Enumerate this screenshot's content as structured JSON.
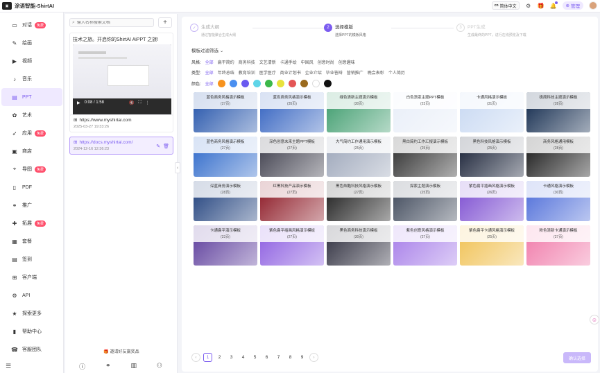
{
  "app": {
    "title": "涂语智能-ShirtAI"
  },
  "topbar": {
    "lang_code": "cn",
    "lang_label": "简体中文",
    "manage_label": "管理"
  },
  "sidebar": {
    "items": [
      {
        "label": "对话",
        "icon": "chat-icon",
        "badge": "免费"
      },
      {
        "label": "绘画",
        "icon": "paint-icon",
        "badge": ""
      },
      {
        "label": "视频",
        "icon": "video-icon",
        "badge": ""
      },
      {
        "label": "音乐",
        "icon": "music-icon",
        "badge": ""
      },
      {
        "label": "PPT",
        "icon": "ppt-icon",
        "badge": "",
        "active": true
      },
      {
        "label": "艺术",
        "icon": "art-icon",
        "badge": ""
      },
      {
        "label": "应用",
        "icon": "rocket-icon",
        "badge": "免费"
      },
      {
        "label": "商店",
        "icon": "store-icon",
        "badge": ""
      },
      {
        "label": "导图",
        "icon": "mindmap-icon",
        "badge": "免费"
      },
      {
        "label": "PDF",
        "icon": "pdf-icon",
        "badge": ""
      },
      {
        "label": "推广",
        "icon": "promote-icon",
        "badge": ""
      },
      {
        "label": "拓展",
        "icon": "puzzle-icon",
        "badge": "免费"
      },
      {
        "label": "套餐",
        "icon": "package-icon",
        "badge": ""
      },
      {
        "label": "签到",
        "icon": "calendar-icon",
        "badge": ""
      },
      {
        "label": "客户端",
        "icon": "windows-icon",
        "badge": ""
      },
      {
        "label": "API",
        "icon": "api-icon",
        "badge": ""
      },
      {
        "label": "探索更多",
        "icon": "star-icon",
        "badge": ""
      },
      {
        "label": "帮助中心",
        "icon": "doc-icon",
        "badge": ""
      },
      {
        "label": "客服团队",
        "icon": "support-icon",
        "badge": ""
      }
    ]
  },
  "history": {
    "search_placeholder": "输入名称搜索文档",
    "video_title": "技术之旅。开启你的ShirtAI AiPPT 之旅!",
    "video_time": "0:08 / 1:58",
    "items": [
      {
        "url": "https://www.myshirtai.com",
        "date": "2025-03-27 19:33:26"
      },
      {
        "url": "https://docs.myshirtai.com/",
        "date": "2024-12-16 12:36:23"
      }
    ],
    "invite_label": "邀请好友赢奖品"
  },
  "steps": [
    {
      "num": "✓",
      "title": "生成大纲",
      "sub": "通过智能聚合生成大纲"
    },
    {
      "num": "2",
      "title": "选择模版",
      "sub": "选择PPT的模板风格"
    },
    {
      "num": "3",
      "title": "PPT生成",
      "sub": "生成最终的PPT，进行在线预览及下载"
    }
  ],
  "filters": {
    "toggle_label": "模板过滤筛选",
    "style_label": "风格:",
    "styles": [
      "全部",
      "扁平简约",
      "商务科技",
      "文艺清新",
      "卡通手绘",
      "中国风",
      "创意时尚",
      "创意趣味"
    ],
    "type_label": "类型:",
    "types": [
      "全部",
      "年终总结",
      "教育培训",
      "医学医疗",
      "商业计划书",
      "企业介绍",
      "毕业答辩",
      "营销推广",
      "晚会表彰",
      "个人简历"
    ],
    "color_label": "颜色:",
    "color_all": "全部",
    "colors": [
      "#f7931e",
      "#4a8ff0",
      "#6a5af0",
      "#5fd5e8",
      "#3cb84a",
      "#e8e23c",
      "#e45656",
      "#9a6a1e",
      "#ffffff",
      "#111111"
    ]
  },
  "templates": [
    {
      "name": "蓝色商务风格演示模板",
      "count": "(27页)",
      "bg": "#1e4fa8"
    },
    {
      "name": "蓝色商务风格演示模板",
      "count": "(35页)",
      "bg": "#2f5fbf"
    },
    {
      "name": "绿色清新主题演示模板",
      "count": "(30页)",
      "bg": "#3a9a6a"
    },
    {
      "name": "白色渐变主题PPT模板",
      "count": "(23页)",
      "bg": "#e8eef8"
    },
    {
      "name": "卡通风格演示模板",
      "count": "(31页)",
      "bg": "#c7d8f2"
    },
    {
      "name": "极简科技主题演示模板",
      "count": "(28页)",
      "bg": "#0b2448"
    },
    {
      "name": "蓝色商务风格演示模板",
      "count": "(27页)",
      "bg": "#2a66c9"
    },
    {
      "name": "深色创意未来主题PPT模板",
      "count": "(27页)",
      "bg": "#3a3a48"
    },
    {
      "name": "大气简约工作通用演示模板",
      "count": "(25页)",
      "bg": "#9aa4b8"
    },
    {
      "name": "黑白简约工作汇报演示模板",
      "count": "(25页)",
      "bg": "#2a2a2a"
    },
    {
      "name": "黑色科技风格演示模板",
      "count": "(25页)",
      "bg": "#111a30"
    },
    {
      "name": "商务风格通用模板",
      "count": "(28页)",
      "bg": "#141414"
    },
    {
      "name": "深蓝商务演示模板",
      "count": "(28页)",
      "bg": "#1c3d7a"
    },
    {
      "name": "红黑科技产品演示模板",
      "count": "(27页)",
      "bg": "#8a1420"
    },
    {
      "name": "黑色炫酷科技风格演示模板",
      "count": "(27页)",
      "bg": "#181818"
    },
    {
      "name": "探索主题演示模板",
      "count": "(25页)",
      "bg": "#3a4456"
    },
    {
      "name": "紫色扁平插画风格演示模板",
      "count": "(26页)",
      "bg": "#7a4ad0"
    },
    {
      "name": "卡通风格演示模板",
      "count": "(30页)",
      "bg": "#4a6ad8"
    },
    {
      "name": "卡通扁平演示模板",
      "count": "(23页)",
      "bg": "#5a3a9a"
    },
    {
      "name": "紫色扁平插画风格演示模板",
      "count": "(27页)",
      "bg": "#8a5ae0"
    },
    {
      "name": "黑色商务科技演示模板",
      "count": "(30页)",
      "bg": "#2a2a3a"
    },
    {
      "name": "紫色创意风格演示模板",
      "count": "(27页)",
      "bg": "#a47ae8"
    },
    {
      "name": "紫色扁平卡通风格演示模板",
      "count": "(25页)",
      "bg": "#f0c050"
    },
    {
      "name": "粉色清新卡通演示模板",
      "count": "(27页)",
      "bg": "#f078a8"
    }
  ],
  "pagination": {
    "pages": [
      "1",
      "2",
      "3",
      "4",
      "5",
      "6",
      "7",
      "8",
      "9"
    ],
    "current": "1"
  },
  "confirm_label": "确认选择"
}
